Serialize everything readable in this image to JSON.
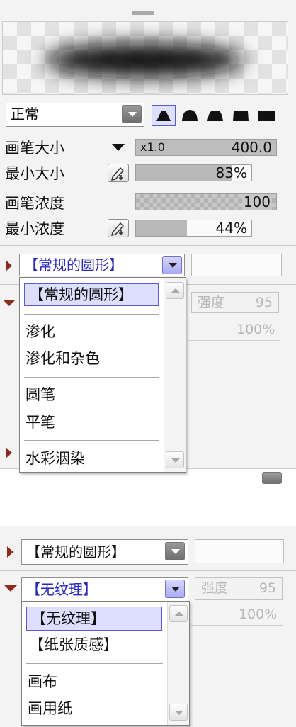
{
  "brush_panel": {
    "blend_mode": "正常",
    "shape_buttons": [
      "cone-shape-icon",
      "round-shape-icon",
      "trapezoid-shape-icon",
      "flat-shape-icon",
      "square-shape-icon"
    ],
    "brush_size": {
      "label": "画笔大小",
      "multiplier": "x1.0",
      "value": "400.0"
    },
    "min_size": {
      "label": "最小大小",
      "value": "83%",
      "fill": 0.83
    },
    "brush_density": {
      "label": "画笔浓度",
      "value": "100"
    },
    "min_density": {
      "label": "最小浓度",
      "value": "44%",
      "fill": 0.44
    }
  },
  "top_section": {
    "shape_combo": "【常规的圆形】",
    "faded_box_label": "强度",
    "faded_box_value": "95",
    "faded_percent": "100%",
    "dropdown": {
      "items": [
        "【常规的圆形】",
        "渗化",
        "渗化和杂色",
        "圆笔",
        "平笔",
        "水彩洇染"
      ]
    }
  },
  "bottom_section": {
    "shape_combo": "【常规的圆形】",
    "texture_combo": "【无纹理】",
    "faded_box_label": "强度",
    "faded_box_value": "95",
    "faded_percent": "100%",
    "dropdown": {
      "items": [
        "【无纹理】",
        "【纸张质感】",
        "画布",
        "画用纸"
      ]
    }
  },
  "colors": {
    "panel_bg": "#f3f3f3",
    "selection_bg": "#dedeff",
    "selection_border": "#5b5bd0",
    "arrow": "#8b2c1e"
  }
}
